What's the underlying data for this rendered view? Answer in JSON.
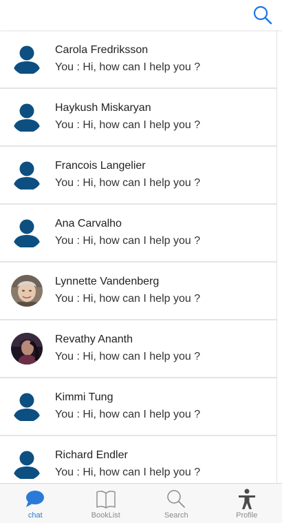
{
  "header": {
    "search_icon": "search-icon",
    "accent_color": "#1a73e8"
  },
  "chats": [
    {
      "name": "Carola Fredriksson",
      "preview": "You : Hi, how can I help you ?",
      "avatar": "default-avatar-icon"
    },
    {
      "name": "Haykush Miskaryan",
      "preview": "You : Hi, how can I help you ?",
      "avatar": "default-avatar-icon"
    },
    {
      "name": "Francois Langelier",
      "preview": "You : Hi, how can I help you ?",
      "avatar": "default-avatar-icon"
    },
    {
      "name": "Ana Carvalho",
      "preview": "You : Hi, how can I help you ?",
      "avatar": "default-avatar-icon"
    },
    {
      "name": "Lynnette Vandenberg",
      "preview": "You : Hi, how can I help you ?",
      "avatar": "photo-avatar"
    },
    {
      "name": "Revathy Ananth",
      "preview": "You : Hi, how can I help you ?",
      "avatar": "photo-avatar"
    },
    {
      "name": "Kimmi Tung",
      "preview": "You : Hi, how can I help you ?",
      "avatar": "default-avatar-icon"
    },
    {
      "name": "Richard Endler",
      "preview": "You : Hi, how can I help you ?",
      "avatar": "default-avatar-icon"
    }
  ],
  "avatar_color": "#0d4f80",
  "bottom_nav": {
    "active_color": "#2a7bd8",
    "inactive_color": "#8a8a8a",
    "tabs": [
      {
        "label": "chat",
        "icon": "chat-bubble-icon",
        "active": true
      },
      {
        "label": "BookList",
        "icon": "book-icon",
        "active": false
      },
      {
        "label": "Search",
        "icon": "search-icon",
        "active": false
      },
      {
        "label": "Profile",
        "icon": "person-icon",
        "active": false
      }
    ]
  }
}
